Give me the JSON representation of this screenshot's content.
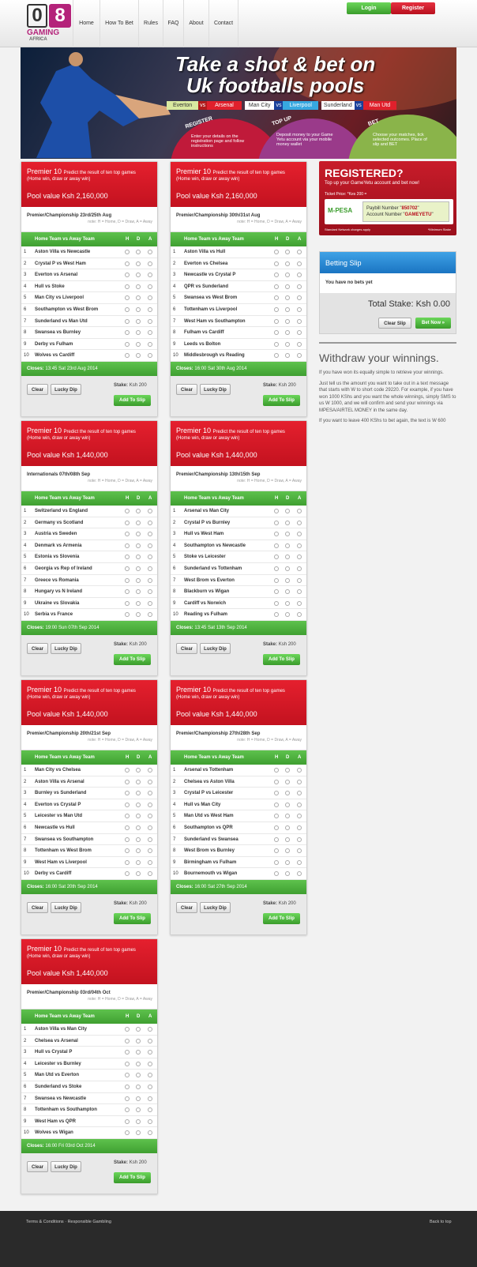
{
  "nav": {
    "logo_digits": "08",
    "logo_text": "GAMING",
    "logo_sub": "AFRICA",
    "items": [
      "Home",
      "How To Bet",
      "Rules",
      "FAQ",
      "About",
      "Contact"
    ],
    "login": "Login",
    "register": "Register"
  },
  "banner": {
    "headline1": "Take a shot & bet on",
    "headline2": "Uk footballs pools",
    "fixtures": [
      {
        "home": "Everton",
        "away": "Arsenal"
      },
      {
        "home": "Man City",
        "away": "Liverpool"
      },
      {
        "home": "Sunderland",
        "away": "Man Utd"
      }
    ],
    "vs": "vs",
    "steps": [
      {
        "title": "REGISTER",
        "text": "Enter your details on the registration page and follow instructions"
      },
      {
        "title": "TOP UP",
        "text": "Deposit money to your Game Yetu account via your mobile money wallet"
      },
      {
        "title": "BET",
        "text": "Choose your matches, tick selected outcomes. Place of slip and BET"
      }
    ]
  },
  "coupon_common": {
    "title": "Premier 10",
    "subtitle1": "Predict the result of ten top games",
    "subtitle2": "(Home win, draw or away win)",
    "note": "note: H = Home, D = Draw, A = Away",
    "header_match": "Home Team vs Away Team",
    "h": "H",
    "d": "D",
    "a": "A",
    "clear": "Clear",
    "lucky": "Lucky Dip",
    "stake_label": "Stake:",
    "stake_value": "Ksh 200",
    "add": "Add To Slip"
  },
  "coupons": [
    {
      "pool": "Pool value Ksh 2,160,000",
      "round": "Premier/Championship 23rd/25th Aug",
      "closes": "Closes:",
      "closes_time": "13:45 Sat 23rd Aug 2014",
      "matches": [
        "Aston Villa vs Newcastle",
        "Crystal P vs West Ham",
        "Everton vs Arsenal",
        "Hull vs Stoke",
        "Man City vs Liverpool",
        "Southampton vs West Brom",
        "Sunderland vs Man Utd",
        "Swansea vs Burnley",
        "Derby vs Fulham",
        "Wolves vs Cardiff"
      ]
    },
    {
      "pool": "Pool value Ksh 2,160,000",
      "round": "Premier/Championship 30th/31st Aug",
      "closes": "Closes:",
      "closes_time": "16:00 Sat 30th Aug 2014",
      "matches": [
        "Aston Villa vs Hull",
        "Everton vs Chelsea",
        "Newcastle vs Crystal P",
        "QPR vs Sunderland",
        "Swansea vs West Brom",
        "Tottenham vs Liverpool",
        "West Ham vs Southampton",
        "Fulham vs Cardiff",
        "Leeds vs Bolton",
        "Middlesbrough vs Reading"
      ]
    },
    {
      "pool": "Pool value Ksh 1,440,000",
      "round": "Internationals 07th/08th Sep",
      "closes": "Closes:",
      "closes_time": "19:00 Sun 07th Sep 2014",
      "matches": [
        "Switzerland vs England",
        "Germany vs Scotland",
        "Austria vs Sweden",
        "Denmark vs Armenia",
        "Estonia vs Slovenia",
        "Georgia vs Rep of Ireland",
        "Greece vs Romania",
        "Hungary vs N Ireland",
        "Ukraine vs Slovakia",
        "Serbia vs France"
      ]
    },
    {
      "pool": "Pool value Ksh 1,440,000",
      "round": "Premier/Championship 13th/15th Sep",
      "closes": "Closes:",
      "closes_time": "13:45 Sat 13th Sep 2014",
      "matches": [
        "Arsenal vs Man City",
        "Crystal P vs Burnley",
        "Hull vs West Ham",
        "Southampton vs Newcastle",
        "Stoke vs Leicester",
        "Sunderland vs Tottenham",
        "West Brom vs Everton",
        "Blackburn vs Wigan",
        "Cardiff vs Norwich",
        "Reading vs Fulham"
      ]
    },
    {
      "pool": "Pool value Ksh 1,440,000",
      "round": "Premier/Championship 20th/21st Sep",
      "closes": "Closes:",
      "closes_time": "16:00 Sat 20th Sep 2014",
      "matches": [
        "Man City vs Chelsea",
        "Aston Villa vs Arsenal",
        "Burnley vs Sunderland",
        "Everton vs Crystal P",
        "Leicester vs Man Utd",
        "Newcastle vs Hull",
        "Swansea vs Southampton",
        "Tottenham vs West Brom",
        "West Ham vs Liverpool",
        "Derby vs Cardiff"
      ]
    },
    {
      "pool": "Pool value Ksh 1,440,000",
      "round": "Premier/Championship 27th/28th Sep",
      "closes": "Closes:",
      "closes_time": "16:00 Sat 27th Sep 2014",
      "matches": [
        "Arsenal vs Tottenham",
        "Chelsea vs Aston Villa",
        "Crystal P vs Leicester",
        "Hull vs Man City",
        "Man Utd vs West Ham",
        "Southampton vs QPR",
        "Sunderland vs Swansea",
        "West Brom vs Burnley",
        "Birmingham vs Fulham",
        "Bournemouth vs Wigan"
      ]
    },
    {
      "pool": "Pool value Ksh 1,440,000",
      "round": "Premier/Championship 03rd/04th Oct",
      "closes": "Closes:",
      "closes_time": "16:00 Fri 03rd Oct 2014",
      "matches": [
        "Aston Villa vs Man City",
        "Chelsea vs Arsenal",
        "Hull vs Crystal P",
        "Leicester vs Burnley",
        "Man Utd vs Everton",
        "Sunderland vs Stoke",
        "Swansea vs Newcastle",
        "Tottenham vs Southampton",
        "West Ham vs QPR",
        "Wolves vs Wigan"
      ]
    }
  ],
  "registered": {
    "title": "REGISTERED?",
    "sub": "Top up your GameYetu account and bet now!",
    "ticket": "Ticket Price: *Kes 200 =",
    "mpesa": "M-PESA",
    "paybill_label": "Paybill Number",
    "paybill": "850702",
    "account_label": "Account Number",
    "account": "GAMEYETU",
    "fine_left": "Standard Network charges apply",
    "fine_right": "*Minimum Stake"
  },
  "slip": {
    "title": "Betting Slip",
    "empty": "You have no bets yet",
    "total": "Total Stake: Ksh 0.00",
    "clear": "Clear Slip",
    "bet": "Bet Now »"
  },
  "withdraw": {
    "title": "Withdraw your winnings.",
    "p1": "If you have won its equally simple to retrieve your winnings.",
    "p2": "Just tell us the amount you want to take out in a text message that starts with W to short code 29220. For example, if you have won 1000 KShs and you want the whole winnings, simply SMS to us W 1000, and we will confirm and send your winnings via MPESA/AIRTEL MONEY in the same day.",
    "p3": "If you want to leave 400 KShs to bet again, the text is W 600"
  },
  "footer": {
    "links": "Terms & Conditions · Responsible Gambling",
    "top": "Back to top"
  },
  "colors": {
    "red": "#d7192a",
    "green": "#4bae3c",
    "blue": "#1e88d4"
  }
}
